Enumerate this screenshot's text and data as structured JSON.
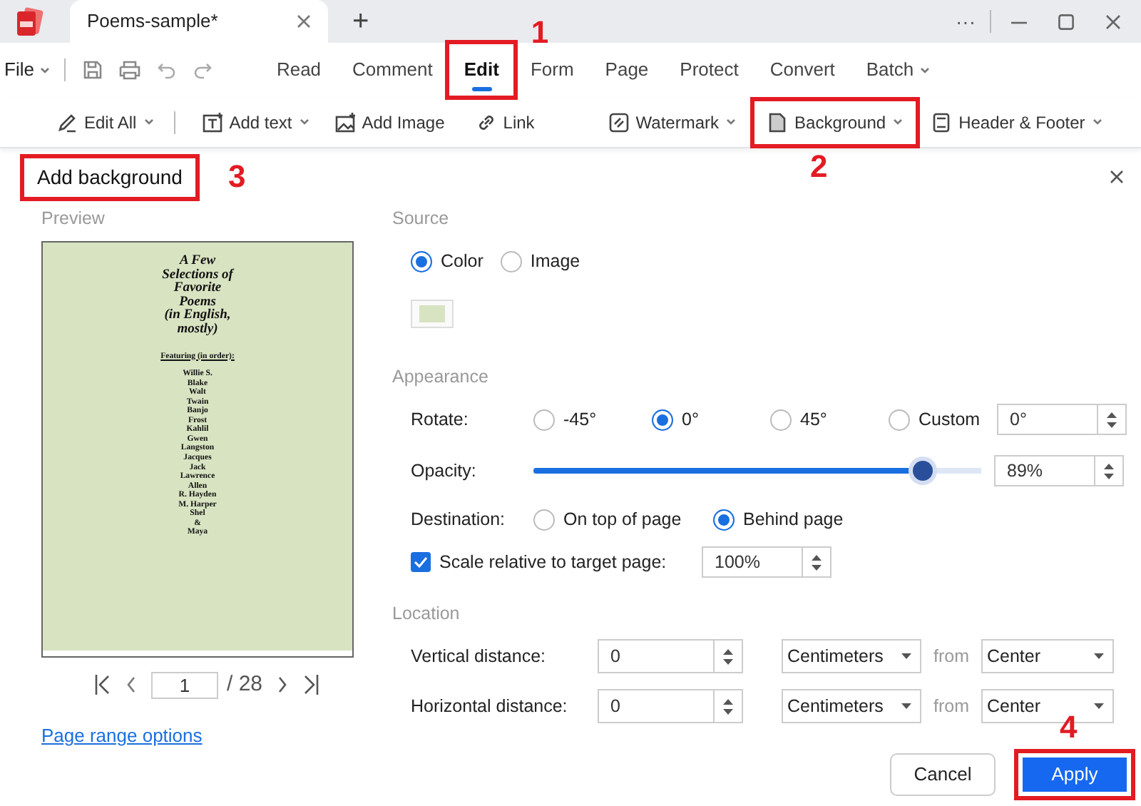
{
  "app": {
    "tab_title": "Poems-sample*",
    "new_tab": "+",
    "more": "···"
  },
  "menu": {
    "file": "File",
    "tabs": [
      {
        "label": "Read",
        "selected": false,
        "dropdown": false
      },
      {
        "label": "Comment",
        "selected": false,
        "dropdown": false
      },
      {
        "label": "Edit",
        "selected": true,
        "dropdown": false,
        "highlighted": true,
        "callout": "1"
      },
      {
        "label": "Form",
        "selected": false,
        "dropdown": false
      },
      {
        "label": "Page",
        "selected": false,
        "dropdown": false
      },
      {
        "label": "Protect",
        "selected": false,
        "dropdown": false
      },
      {
        "label": "Convert",
        "selected": false,
        "dropdown": false
      },
      {
        "label": "Batch",
        "selected": false,
        "dropdown": true
      }
    ]
  },
  "toolbar": [
    {
      "label": "Edit All",
      "kind": "edit",
      "dropdown": true
    },
    {
      "label": "Add text",
      "kind": "text",
      "dropdown": true
    },
    {
      "label": "Add Image",
      "kind": "image",
      "dropdown": false
    },
    {
      "label": "Link",
      "kind": "link",
      "dropdown": false
    },
    {
      "label": "Watermark",
      "kind": "watermark",
      "dropdown": true
    },
    {
      "label": "Background",
      "kind": "background",
      "dropdown": true,
      "highlighted": true,
      "callout": "2"
    },
    {
      "label": "Header & Footer",
      "kind": "header",
      "dropdown": true
    }
  ],
  "dialog": {
    "title": "Add background",
    "highlighted": true,
    "callout": "3"
  },
  "preview": {
    "heading": "Preview",
    "title_lines": [
      "A Few",
      "Selections of",
      "Favorite",
      "Poems",
      "(in English,",
      "mostly)"
    ],
    "featuring": "Featuring (in order):",
    "names": [
      "Willie S.",
      "Blake",
      "Walt",
      "Twain",
      "Banjo",
      "Frost",
      "Kahlil",
      "Gwen",
      "Langston",
      "Jacques",
      "Jack",
      "Lawrence",
      "Allen",
      "R. Hayden",
      "M. Harper",
      "Shel",
      "&",
      "Maya"
    ],
    "page_number": "1",
    "page_total": "/ 28",
    "range_link": "Page range options"
  },
  "source": {
    "heading": "Source",
    "options": [
      {
        "label": "Color",
        "selected": true
      },
      {
        "label": "Image",
        "selected": false
      }
    ],
    "color": "#d8e3c2"
  },
  "appearance": {
    "heading": "Appearance",
    "rotate": {
      "label": "Rotate:",
      "options": [
        {
          "label": "-45°",
          "selected": false
        },
        {
          "label": "0°",
          "selected": true
        },
        {
          "label": "45°",
          "selected": false
        },
        {
          "label": "Custom",
          "selected": false
        }
      ],
      "value": "0°"
    },
    "opacity": {
      "label": "Opacity:",
      "level": 0.87,
      "value": "89%"
    },
    "destination": {
      "label": "Destination:",
      "options": [
        {
          "label": "On top of page",
          "selected": false
        },
        {
          "label": "Behind page",
          "selected": true
        }
      ]
    },
    "scale": {
      "label": "Scale relative to target page:",
      "checked": true,
      "value": "100%"
    }
  },
  "location": {
    "heading": "Location",
    "rows": [
      {
        "label": "Vertical distance:",
        "value": "0",
        "unit": "Centimeters",
        "from": "from",
        "anchor": "Center"
      },
      {
        "label": "Horizontal distance:",
        "value": "0",
        "unit": "Centimeters",
        "from": "from",
        "anchor": "Center"
      }
    ]
  },
  "buttons": [
    {
      "label": "Cancel",
      "kind": "secondary"
    },
    {
      "label": "Apply",
      "kind": "primary",
      "highlighted": true,
      "callout": "4"
    }
  ]
}
